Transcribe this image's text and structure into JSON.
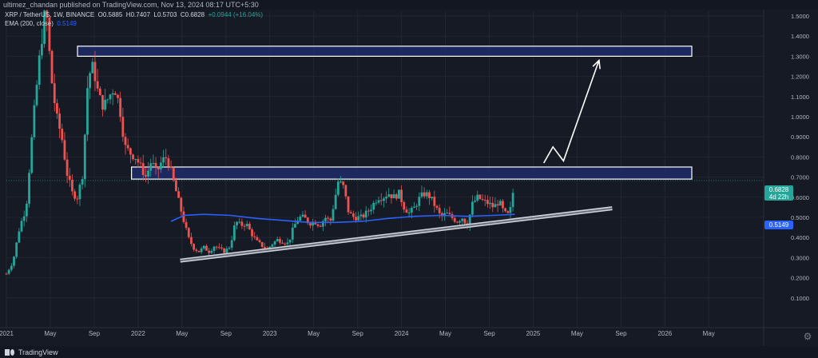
{
  "header": {
    "publish_line": "ultimez_chandan published on TradingView.com, Nov 13, 2024 08:17 UTC+5:30"
  },
  "legend": {
    "symbol": "XRP / TetherUS, 1W, BINANCE",
    "ohlc_open": "O0.5885",
    "ohlc_high": "H0.7407",
    "ohlc_low": "L0.5703",
    "ohlc_close": "C0.6828",
    "change": "+0.0944 (+16.04%)",
    "ema_label": "EMA (200, close)",
    "ema_value": "0.5149"
  },
  "price_tags": {
    "price": "0.6828",
    "countdown": "4d 22h",
    "ema": "0.5149"
  },
  "footer": {
    "brand": "TradingView"
  },
  "colors": {
    "background": "#161a25",
    "up": "#26a69a",
    "down": "#ef5350",
    "ema": "#2962ff",
    "zone_fill": "#1e2c68",
    "zone_border": "#ffffff",
    "grid": "#222633",
    "axis_text": "#b2b5be"
  },
  "chart_data": {
    "type": "candlestick",
    "title": "XRP / TetherUS, 1W, BINANCE",
    "y_axis_side": "right",
    "ylim": [
      0.0,
      1.5
    ],
    "y_ticks": [
      0.1,
      0.2,
      0.3,
      0.4,
      0.5,
      0.6,
      0.7,
      0.8,
      0.9,
      1.0,
      1.1,
      1.2,
      1.3,
      1.4,
      1.5
    ],
    "y_tick_labels": [
      "0.1000",
      "0.2000",
      "0.3000",
      "0.4000",
      "0.5000",
      "0.6000",
      "0.7000",
      "0.8000",
      "0.9000",
      "1.0000",
      "1.1000",
      "1.2000",
      "1.3000",
      "1.4000",
      "1.5000"
    ],
    "x_range": [
      2021.0,
      2026.75
    ],
    "x_ticks": [
      {
        "label": "2021",
        "t": 2021.0
      },
      {
        "label": "May",
        "t": 2021.333
      },
      {
        "label": "Sep",
        "t": 2021.667
      },
      {
        "label": "2022",
        "t": 2022.0
      },
      {
        "label": "May",
        "t": 2022.333
      },
      {
        "label": "Sep",
        "t": 2022.667
      },
      {
        "label": "2023",
        "t": 2023.0
      },
      {
        "label": "May",
        "t": 2023.333
      },
      {
        "label": "Sep",
        "t": 2023.667
      },
      {
        "label": "2024",
        "t": 2024.0
      },
      {
        "label": "May",
        "t": 2024.333
      },
      {
        "label": "Sep",
        "t": 2024.667
      },
      {
        "label": "2025",
        "t": 2025.0
      },
      {
        "label": "May",
        "t": 2025.333
      },
      {
        "label": "Sep",
        "t": 2025.667
      },
      {
        "label": "2026",
        "t": 2026.0
      },
      {
        "label": "May",
        "t": 2026.333
      }
    ],
    "price_series_key": [
      [
        2021.0,
        0.22
      ],
      [
        2021.05,
        0.28
      ],
      [
        2021.1,
        0.45
      ],
      [
        2021.15,
        0.55
      ],
      [
        2021.2,
        0.95
      ],
      [
        2021.26,
        1.35
      ],
      [
        2021.3,
        1.55
      ],
      [
        2021.34,
        1.2
      ],
      [
        2021.38,
        1.0
      ],
      [
        2021.42,
        0.9
      ],
      [
        2021.46,
        0.72
      ],
      [
        2021.5,
        0.62
      ],
      [
        2021.54,
        0.6
      ],
      [
        2021.58,
        0.72
      ],
      [
        2021.62,
        1.2
      ],
      [
        2021.66,
        1.25
      ],
      [
        2021.7,
        1.1
      ],
      [
        2021.74,
        1.05
      ],
      [
        2021.78,
        1.1
      ],
      [
        2021.82,
        1.15
      ],
      [
        2021.86,
        1.05
      ],
      [
        2021.9,
        0.85
      ],
      [
        2021.94,
        0.82
      ],
      [
        2021.98,
        0.8
      ],
      [
        2022.02,
        0.75
      ],
      [
        2022.06,
        0.7
      ],
      [
        2022.1,
        0.78
      ],
      [
        2022.14,
        0.72
      ],
      [
        2022.18,
        0.78
      ],
      [
        2022.22,
        0.8
      ],
      [
        2022.26,
        0.7
      ],
      [
        2022.3,
        0.6
      ],
      [
        2022.34,
        0.5
      ],
      [
        2022.38,
        0.4
      ],
      [
        2022.42,
        0.35
      ],
      [
        2022.46,
        0.33
      ],
      [
        2022.5,
        0.35
      ],
      [
        2022.54,
        0.33
      ],
      [
        2022.58,
        0.36
      ],
      [
        2022.62,
        0.34
      ],
      [
        2022.66,
        0.33
      ],
      [
        2022.7,
        0.36
      ],
      [
        2022.74,
        0.48
      ],
      [
        2022.78,
        0.46
      ],
      [
        2022.82,
        0.47
      ],
      [
        2022.86,
        0.42
      ],
      [
        2022.9,
        0.38
      ],
      [
        2022.94,
        0.36
      ],
      [
        2022.98,
        0.34
      ],
      [
        2023.02,
        0.37
      ],
      [
        2023.06,
        0.39
      ],
      [
        2023.1,
        0.38
      ],
      [
        2023.14,
        0.37
      ],
      [
        2023.18,
        0.45
      ],
      [
        2023.22,
        0.5
      ],
      [
        2023.26,
        0.5
      ],
      [
        2023.3,
        0.47
      ],
      [
        2023.34,
        0.48
      ],
      [
        2023.38,
        0.46
      ],
      [
        2023.42,
        0.5
      ],
      [
        2023.46,
        0.48
      ],
      [
        2023.52,
        0.68
      ],
      [
        2023.56,
        0.65
      ],
      [
        2023.6,
        0.52
      ],
      [
        2023.64,
        0.5
      ],
      [
        2023.7,
        0.5
      ],
      [
        2023.76,
        0.54
      ],
      [
        2023.82,
        0.6
      ],
      [
        2023.86,
        0.6
      ],
      [
        2023.9,
        0.62
      ],
      [
        2023.94,
        0.6
      ],
      [
        2023.98,
        0.62
      ],
      [
        2024.02,
        0.55
      ],
      [
        2024.06,
        0.52
      ],
      [
        2024.1,
        0.55
      ],
      [
        2024.14,
        0.6
      ],
      [
        2024.18,
        0.62
      ],
      [
        2024.22,
        0.6
      ],
      [
        2024.26,
        0.55
      ],
      [
        2024.3,
        0.5
      ],
      [
        2024.34,
        0.52
      ],
      [
        2024.38,
        0.5
      ],
      [
        2024.42,
        0.48
      ],
      [
        2024.46,
        0.5
      ],
      [
        2024.5,
        0.46
      ],
      [
        2024.54,
        0.57
      ],
      [
        2024.58,
        0.6
      ],
      [
        2024.62,
        0.58
      ],
      [
        2024.66,
        0.57
      ],
      [
        2024.7,
        0.55
      ],
      [
        2024.74,
        0.58
      ],
      [
        2024.78,
        0.52
      ],
      [
        2024.82,
        0.51
      ],
      [
        2024.86,
        0.6828
      ]
    ],
    "ema": {
      "name": "EMA (200, close)",
      "points": [
        [
          2022.25,
          0.48
        ],
        [
          2022.35,
          0.51
        ],
        [
          2022.5,
          0.515
        ],
        [
          2022.7,
          0.51
        ],
        [
          2022.9,
          0.495
        ],
        [
          2023.1,
          0.485
        ],
        [
          2023.3,
          0.475
        ],
        [
          2023.5,
          0.475
        ],
        [
          2023.7,
          0.48
        ],
        [
          2023.9,
          0.495
        ],
        [
          2024.1,
          0.505
        ],
        [
          2024.3,
          0.51
        ],
        [
          2024.5,
          0.505
        ],
        [
          2024.7,
          0.51
        ],
        [
          2024.86,
          0.5149
        ]
      ]
    },
    "annotations": {
      "supply_zone_upper": {
        "t0": 2021.54,
        "t1": 2026.75,
        "p_low": 1.3,
        "p_high": 1.35
      },
      "supply_zone_mid": {
        "t0": 2021.95,
        "t1": 2026.75,
        "p_low": 0.69,
        "p_high": 0.75
      },
      "support_trendline": {
        "t0": 2022.32,
        "p0": 0.285,
        "t1": 2025.6,
        "p1": 0.545
      },
      "projection_arrow": [
        [
          2025.08,
          0.77
        ],
        [
          2025.15,
          0.85
        ],
        [
          2025.23,
          0.78
        ],
        [
          2025.5,
          1.28
        ]
      ]
    }
  }
}
